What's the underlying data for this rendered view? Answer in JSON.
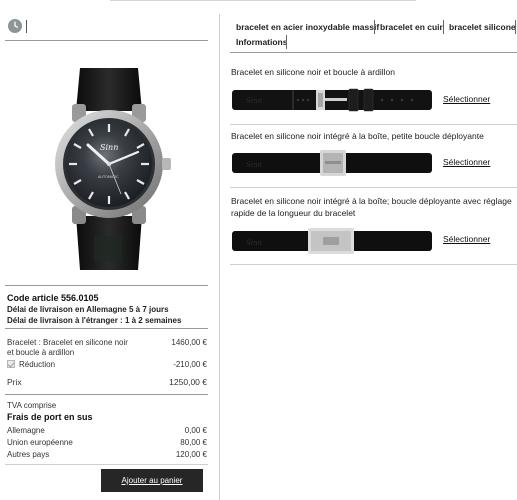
{
  "icons": {
    "clock": "clock-icon"
  },
  "product": {
    "code": "Code article 556.0105",
    "delivery_de": "Délai de livraison en Allemagne 5 à 7 jours",
    "delivery_abroad": "Délai de livraison à l'étranger : 1 à 2 semaines",
    "watch_brand": "Sinn",
    "watch_dial_text": "AUTOMATIC"
  },
  "pricing": {
    "bracelet_label": "Bracelet : Bracelet en silicone noir",
    "bracelet_label_2": "et boucle à ardillon",
    "bracelet_price": "1460,00 €",
    "reduction_label": "Réduction",
    "reduction_value": "-210,00 €",
    "prix_label": "Prix",
    "prix_value": "1250,00 €",
    "tva": "TVA comprise"
  },
  "shipping": {
    "title": "Frais de port en sus",
    "rows": [
      {
        "label": "Allemagne",
        "value": "0,00 €"
      },
      {
        "label": "Union européenne",
        "value": "80,00 €"
      },
      {
        "label": "Autres pays",
        "value": "120,00 €"
      }
    ]
  },
  "cart_button": "Ajouter au panier",
  "tabs": [
    {
      "label": "bracelet en acier inoxydable massif"
    },
    {
      "label": "bracelet en cuir"
    },
    {
      "label": "bracelet silicone"
    },
    {
      "label": "Informations"
    }
  ],
  "options": [
    {
      "title": "Bracelet en silicone noir et boucle à ardillon",
      "select": "Sélectionner"
    },
    {
      "title": "Bracelet en silicone noir intégré à la boîte, petite boucle déployante",
      "select": "Sélectionner"
    },
    {
      "title": "Bracelet en silicone noir intégré à la boîte; boucle déployante avec réglage rapide de la longueur du bracelet",
      "select": "Sélectionner"
    }
  ],
  "strap_brand": "Sinn",
  "colors": {
    "button_bg": "#262626",
    "rule": "#9a9a9a",
    "strap": "#111111",
    "clasp": "#c9c9c9"
  }
}
